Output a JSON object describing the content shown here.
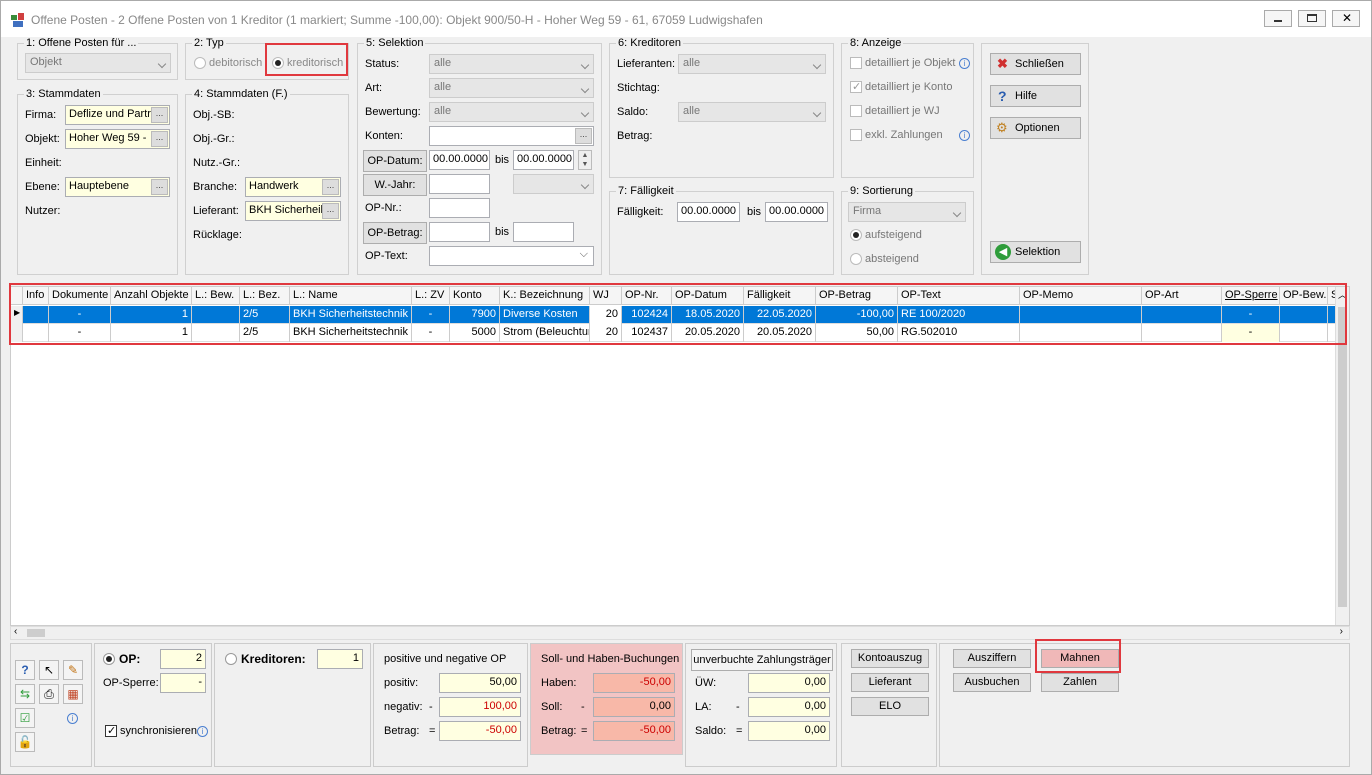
{
  "window": {
    "title": "Offene Posten - 2 Offene Posten von 1 Kreditor (1 markiert; Summe -100,00):  Objekt 900/50-H - Hoher Weg 59 - 61, 67059 Ludwigshafen"
  },
  "g1": {
    "title": "1: Offene Posten für ...",
    "select": "Objekt"
  },
  "g2": {
    "title": "2: Typ",
    "opt1": "debitorisch",
    "opt2": "kreditorisch"
  },
  "g3": {
    "title": "3: Stammdaten",
    "firma_l": "Firma:",
    "firma_v": "Deflize und Partr",
    "objekt_l": "Objekt:",
    "objekt_v": "Hoher Weg 59 -",
    "einheit_l": "Einheit:",
    "ebene_l": "Ebene:",
    "ebene_v": "Hauptebene",
    "nutzer_l": "Nutzer:"
  },
  "g4": {
    "title": "4: Stammdaten (F.)",
    "objsb": "Obj.-SB:",
    "objgr": "Obj.-Gr.:",
    "nutzgr": "Nutz.-Gr.:",
    "branche_l": "Branche:",
    "branche_v": "Handwerk",
    "lief_l": "Lieferant:",
    "lief_v": "BKH Sicherheil",
    "ruecklage": "Rücklage:"
  },
  "g5": {
    "title": "5: Selektion",
    "status_l": "Status:",
    "status_v": "alle",
    "art_l": "Art:",
    "art_v": "alle",
    "bew_l": "Bewertung:",
    "bew_v": "alle",
    "konten_l": "Konten:",
    "opdatum_btn": "OP-Datum:",
    "date_from": "00.00.0000",
    "bis": "bis",
    "date_to": "00.00.0000",
    "wjahr_btn": "W.-Jahr:",
    "opnr_l": "OP-Nr.:",
    "opbetrag_btn": "OP-Betrag:",
    "bis2": "bis",
    "optext_l": "OP-Text:"
  },
  "g6": {
    "title": "6: Kreditoren",
    "lief_l": "Lieferanten:",
    "lief_v": "alle",
    "stichtag": "Stichtag:",
    "saldo_l": "Saldo:",
    "saldo_v": "alle",
    "betrag": "Betrag:"
  },
  "g7": {
    "title": "7: Fälligkeit",
    "f_l": "Fälligkeit:",
    "from": "00.00.0000",
    "bis": "bis",
    "to": "00.00.0000"
  },
  "g8": {
    "title": "8: Anzeige",
    "o1": "detailliert je Objekt",
    "o2": "detailliert je Konto",
    "o3": "detailliert je WJ",
    "o4": "exkl. Zahlungen"
  },
  "g9": {
    "title": "9: Sortierung",
    "select": "Firma",
    "asc": "aufsteigend",
    "desc": "absteigend"
  },
  "actions": {
    "close": "Schließen",
    "help": "Hilfe",
    "options": "Optionen",
    "selection": "Selektion"
  },
  "grid": {
    "headers": [
      "Info",
      "Dokumente",
      "Anzahl Objekte",
      "L.: Bew.",
      "L.: Bez.",
      "L.: Name",
      "L.: ZV",
      "Konto",
      "K.: Bezeichnung",
      "WJ",
      "OP-Nr.",
      "OP-Datum",
      "Fälligkeit",
      "OP-Betrag",
      "OP-Text",
      "OP-Memo",
      "OP-Art",
      "OP-Sperre",
      "OP-Bew.",
      "Sk"
    ],
    "rows": [
      [
        "",
        "-",
        "1",
        "",
        "2/5",
        "BKH Sicherheitstechnik I",
        "-",
        "7900",
        "Diverse Kosten",
        "20",
        "102424",
        "18.05.2020",
        "22.05.2020",
        "-100,00",
        "RE 100/2020",
        "",
        "",
        "-",
        "",
        ""
      ],
      [
        "",
        "-",
        "1",
        "",
        "2/5",
        "BKH Sicherheitstechnik I",
        "-",
        "5000",
        "Strom (Beleuchtur",
        "20",
        "102437",
        "20.05.2020",
        "20.05.2020",
        "50,00",
        "RG.502010",
        "",
        "",
        "-",
        "",
        ""
      ]
    ]
  },
  "bottom": {
    "op_l": "OP:",
    "op_v": "2",
    "sperre_l": "OP-Sperre:",
    "sperre_v": "-",
    "sync": "synchronisieren",
    "kred_l": "Kreditoren:",
    "kred_v": "1",
    "pn_title": "positive und negative OP",
    "pos_l": "positiv:",
    "pos_v": "50,00",
    "neg_l": "negativ:",
    "neg_sign": "-",
    "neg_v": "100,00",
    "bet_l": "Betrag:",
    "bet_sign": "=",
    "bet_v": "-50,00",
    "sh_title": "Soll- und Haben-Buchungen",
    "hab_l": "Haben:",
    "hab_v": "-50,00",
    "soll_l": "Soll:",
    "soll_sign": "-",
    "soll_v": "0,00",
    "sbet_l": "Betrag:",
    "sbet_sign": "=",
    "sbet_v": "-50,00",
    "uz_btn": "unverbuchte Zahlungsträger",
    "uw_l": "ÜW:",
    "uw_v": "0,00",
    "la_l": "LA:",
    "la_sign": "-",
    "la_v": "0,00",
    "saldo_l": "Saldo:",
    "saldo_sign": "=",
    "saldo_v": "0,00",
    "kontoauszug": "Kontoauszug",
    "lieferant": "Lieferant",
    "elo": "ELO",
    "ausziffern": "Ausziffern",
    "mahnen": "Mahnen",
    "ausbuchen": "Ausbuchen",
    "zahlen": "Zahlen"
  }
}
